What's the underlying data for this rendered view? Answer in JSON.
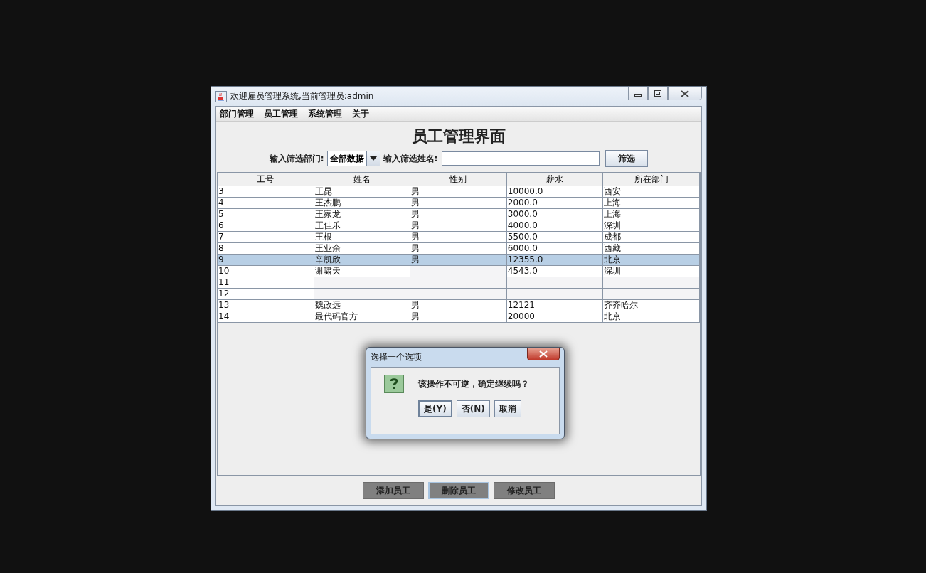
{
  "window": {
    "title": "欢迎雇员管理系统,当前管理员:admin"
  },
  "menu": [
    "部门管理",
    "员工管理",
    "系统管理",
    "关于"
  ],
  "heading": "员工管理界面",
  "filter": {
    "dept_label": "输入筛选部门:",
    "dept_value": "全部数据",
    "name_label": "输入筛选姓名:",
    "button": "筛选"
  },
  "table": {
    "columns": [
      "工号",
      "姓名",
      "性别",
      "薪水",
      "所在部门"
    ],
    "rows": [
      {
        "cells": [
          "3",
          "王昆",
          "男",
          "10000.0",
          "西安"
        ],
        "selected": false
      },
      {
        "cells": [
          "4",
          "王杰鹏",
          "男",
          "2000.0",
          "上海"
        ],
        "selected": false
      },
      {
        "cells": [
          "5",
          "王家龙",
          "男",
          "3000.0",
          "上海"
        ],
        "selected": false
      },
      {
        "cells": [
          "6",
          "王佳乐",
          "男",
          "4000.0",
          "深圳"
        ],
        "selected": false
      },
      {
        "cells": [
          "7",
          "王根",
          "男",
          "5500.0",
          "成都"
        ],
        "selected": false
      },
      {
        "cells": [
          "8",
          "王业余",
          "男",
          "6000.0",
          "西藏"
        ],
        "selected": false
      },
      {
        "cells": [
          "9",
          "辛凯欣",
          "男",
          "12355.0",
          "北京"
        ],
        "selected": true
      },
      {
        "cells": [
          "10",
          "谢啸天",
          "",
          "4543.0",
          "深圳"
        ],
        "selected": false
      },
      {
        "cells": [
          "11",
          "",
          "",
          "",
          ""
        ],
        "selected": false
      },
      {
        "cells": [
          "12",
          "",
          "",
          "",
          ""
        ],
        "selected": false
      },
      {
        "cells": [
          "13",
          "魏政远",
          "男",
          "12121",
          "齐齐哈尔"
        ],
        "selected": false
      },
      {
        "cells": [
          "14",
          "最代码官方",
          "男",
          "20000",
          "北京"
        ],
        "selected": false
      }
    ]
  },
  "buttons": [
    {
      "label": "添加员工",
      "focused": false
    },
    {
      "label": "删除员工",
      "focused": true
    },
    {
      "label": "修改员工",
      "focused": false
    }
  ],
  "dialog": {
    "title": "选择一个选项",
    "message": "该操作不可逆，确定继续吗？",
    "buttons": [
      {
        "label": "是(Y)",
        "focused": true
      },
      {
        "label": "否(N)",
        "focused": false
      },
      {
        "label": "取消",
        "focused": false
      }
    ]
  }
}
